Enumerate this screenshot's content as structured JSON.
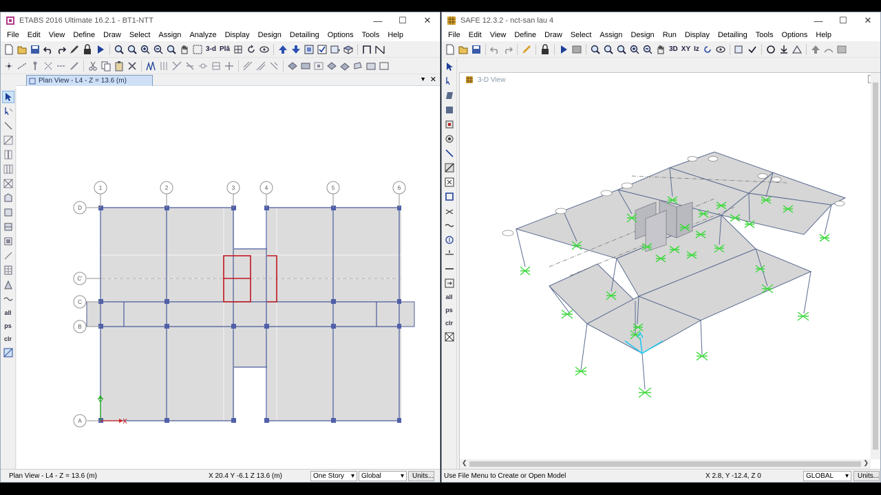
{
  "etabs": {
    "title": "ETABS 2016 Ultimate 16.2.1 - BT1-NTT",
    "menu": [
      "File",
      "Edit",
      "View",
      "Define",
      "Draw",
      "Select",
      "Assign",
      "Analyze",
      "Display",
      "Design",
      "Detailing",
      "Options",
      "Tools",
      "Help"
    ],
    "toolbar_3d_label": "3-d",
    "toolbar_plan_label": "Plâ",
    "tab_label": "Plan View - L4 - Z = 13.6 (m)",
    "left_tools_text": [
      "all",
      "ps",
      "clr"
    ],
    "grid_x": [
      "1",
      "2",
      "3",
      "4",
      "5",
      "6"
    ],
    "grid_y": [
      "D",
      "C'",
      "C",
      "B",
      "A"
    ],
    "status": {
      "view": "Plan View - L4 - Z = 13.6 (m)",
      "coords": "X 20.4  Y -6.1  Z 13.6 (m)",
      "story_option": "One Story",
      "coord_system": "Global",
      "units_button": "Units..."
    },
    "colors": {
      "slab": "#dcdcdc",
      "beam": "#4a5a9a",
      "column": "#5060a8",
      "wall": "#c0141e"
    }
  },
  "safe": {
    "title": "SAFE 12.3.2 - nct-san lau 4",
    "menu": [
      "File",
      "Edit",
      "View",
      "Define",
      "Draw",
      "Select",
      "Assign",
      "Design",
      "Run",
      "Display",
      "Detailing",
      "Tools",
      "Options",
      "Help"
    ],
    "toolbar_labels": [
      "3D",
      "XY",
      "Iz"
    ],
    "left_tools_text": [
      "all",
      "ps",
      "clr"
    ],
    "view_title": "3-D View",
    "status": {
      "message": "Use File Menu to Create or Open Model",
      "coords": "X 2.8,  Y -12.4,  Z 0",
      "coord_system": "GLOBAL",
      "units_button": "Units..."
    },
    "colors": {
      "slab": "#d6d6d6",
      "support": "#3ed93e",
      "axis": "#20c8f0"
    }
  }
}
